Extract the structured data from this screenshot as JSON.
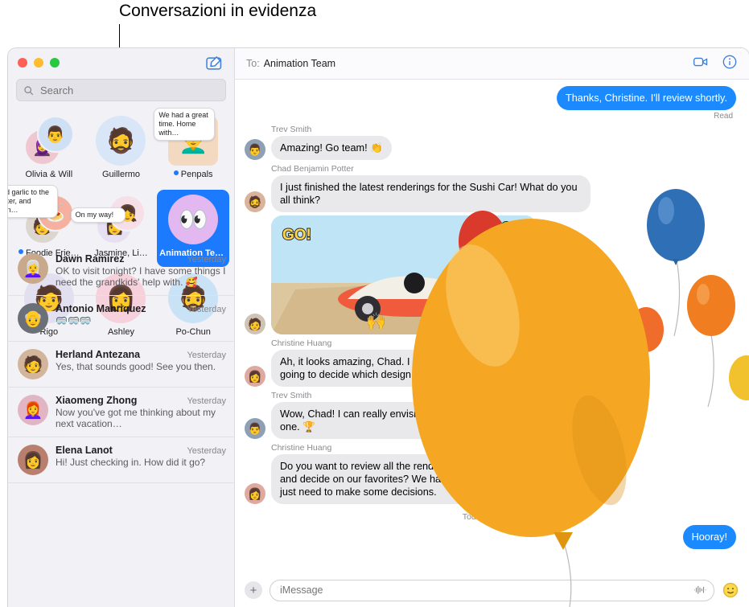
{
  "callout": {
    "text": "Conversazioni in evidenza"
  },
  "window": {
    "traffic": {
      "close": "close-button",
      "minimize": "minimize-button",
      "zoom": "zoom-button"
    }
  },
  "sidebar": {
    "compose_icon": "compose-icon",
    "search": {
      "placeholder": "Search",
      "icon": "search-icon"
    },
    "pinned": [
      {
        "label": "Olivia & Will",
        "unread": false,
        "bubble": null,
        "emoji": "🧕",
        "emoji2": "👨",
        "color": "#efc7d0",
        "color2": "#cfe0f5",
        "type": "duo"
      },
      {
        "label": "Guillermo",
        "unread": false,
        "bubble": null,
        "emoji": "🧔",
        "color": "#d8e6f7",
        "type": "single"
      },
      {
        "label": "Penpals",
        "unread": true,
        "bubble": "We had a great time. Home with…",
        "emoji": "👨‍🦱",
        "color": "#f3d9c0",
        "type": "photo"
      },
      {
        "label": "Foodie Frie…",
        "unread": true,
        "bubble": "Add garlic to the butter, and then…",
        "emoji": "🍝",
        "color": "#f5b0a0",
        "type": "photo"
      },
      {
        "label": "Jasmine, Li…",
        "unread": false,
        "bubble": "On my way!",
        "emoji": "👩",
        "emoji2": "👧",
        "color": "#e7dff2",
        "color2": "#f7dfe7",
        "type": "duo"
      },
      {
        "label": "Animation Team",
        "unread": false,
        "bubble": null,
        "emoji": "👀",
        "color": "#e3b7f0",
        "type": "selected"
      },
      {
        "label": "Rigo",
        "unread": false,
        "bubble": null,
        "emoji": "🧑",
        "color": "#e2dff0",
        "type": "single"
      },
      {
        "label": "Ashley",
        "unread": false,
        "bubble": null,
        "emoji": "👩",
        "color": "#f6d0da",
        "type": "single"
      },
      {
        "label": "Po-Chun",
        "unread": false,
        "bubble": null,
        "emoji": "🧔",
        "color": "#c9e2f6",
        "type": "single"
      }
    ],
    "conversations": [
      {
        "name": "Dawn Ramirez",
        "time": "Yesterday",
        "preview": "OK to visit tonight? I have some things I need the grandkids' help with. 🥰",
        "emoji": "👩‍🦳",
        "color": "#c8a98c"
      },
      {
        "name": "Antonio Manriquez",
        "time": "Yesterday",
        "preview": "🥽🥽🥽",
        "emoji": "👴",
        "color": "#6b6f77"
      },
      {
        "name": "Herland Antezana",
        "time": "Yesterday",
        "preview": "Yes, that sounds good! See you then.",
        "emoji": "🧑",
        "color": "#d2b59a"
      },
      {
        "name": "Xiaomeng Zhong",
        "time": "Yesterday",
        "preview": "Now you've got me thinking about my next vacation…",
        "emoji": "👩‍🦰",
        "color": "#e2b5c4"
      },
      {
        "name": "Elena Lanot",
        "time": "Yesterday",
        "preview": "Hi! Just checking in. How did it go?",
        "emoji": "👩",
        "color": "#b97f6e"
      }
    ]
  },
  "chat": {
    "to_label": "To:",
    "to_value": "Animation Team",
    "facetime_icon": "video-camera-icon",
    "info_icon": "info-icon",
    "messages": [
      {
        "type": "out",
        "text": "Thanks, Christine. I'll review shortly.",
        "bold_prefix": "Thanks, Christine.",
        "status": "Read"
      },
      {
        "type": "in",
        "sender": "Trev Smith",
        "text": "Amazing! Go team! 👏",
        "emoji": "👨",
        "color": "#8ea0b5"
      },
      {
        "type": "in",
        "sender": "Chad Benjamin Potter",
        "text": "I just finished the latest renderings for the Sushi Car! What do you all think?",
        "emoji": "🧔",
        "color": "#d9b49a"
      },
      {
        "type": "image",
        "sender": "",
        "emoji": "🧑",
        "color": "#cfc3b5",
        "stickers": [
          "GO!",
          "ZOOM"
        ]
      },
      {
        "type": "in",
        "sender": "Christine Huang",
        "text": "Ah, it looks amazing, Chad. I love it so much. How are we ever going to decide which design to move forward with?",
        "emoji": "👩",
        "color": "#e0a9a0"
      },
      {
        "type": "in",
        "sender": "Trev Smith",
        "text": "Wow, Chad! I can really envision us taking the trophy home with this one. 🏆",
        "emoji": "👨",
        "color": "#8ea0b5"
      },
      {
        "type": "in",
        "sender": "Christine Huang",
        "text": "Do you want to review all the renders together next time we meet and decide on our favorites? We have so much amazing work here, just need to make some decisions.",
        "emoji": "👩",
        "color": "#e0a9a0"
      }
    ],
    "timestamp": "Today 9:41 AM",
    "hooray_bubble": "Hooray!",
    "input": {
      "placeholder": "iMessage",
      "plus_icon": "add-attachment-icon",
      "audio_icon": "audio-waveform-icon",
      "emoji_icon": "emoji-picker-icon"
    }
  },
  "colors": {
    "accent_blue": "#1c8aff",
    "selection_blue": "#1c7aff",
    "incoming_gray": "#e9e9eb",
    "balloon_orange": "#f5a623",
    "balloon_blue": "#2f6fb5",
    "balloon_red": "#d93a2b"
  }
}
